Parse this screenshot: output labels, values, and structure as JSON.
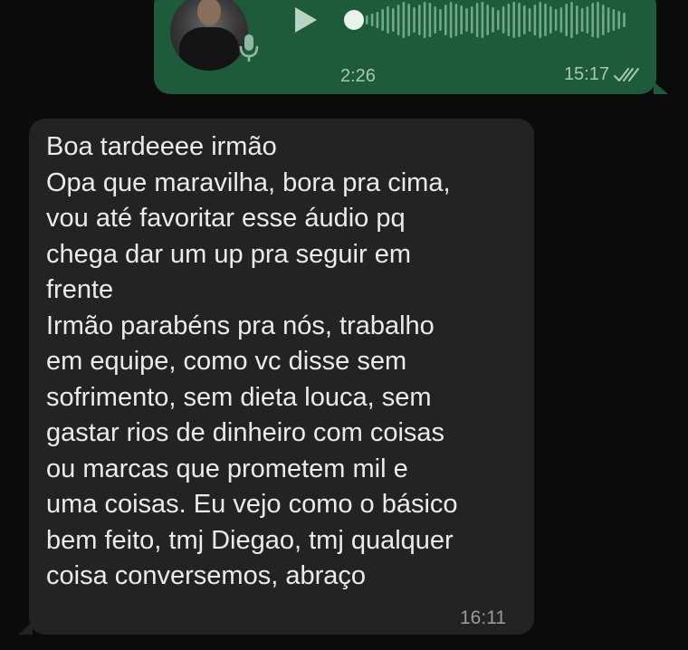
{
  "outgoing_voice_message": {
    "duration": "2:26",
    "time": "15:17",
    "playback_progress": 0.0,
    "status": "read",
    "bubble_color": "#1d5b3a"
  },
  "incoming_message": {
    "lines": [
      "Boa tardeeee irmão",
      "Opa que maravilha, bora pra cima,",
      "vou até favoritar esse áudio pq",
      "chega dar um up pra seguir em",
      "frente",
      "Irmão parabéns pra nós, trabalho",
      "em equipe, como vc disse sem",
      "sofrimento, sem dieta louca, sem",
      "gastar rios de dinheiro com coisas",
      "ou marcas que prometem mil e",
      "uma coisas. Eu vejo como o básico",
      "bem feito, tmj Diegao, tmj qualquer",
      "coisa conversemos, abraço"
    ],
    "time": "16:11",
    "bubble_color": "#232323"
  },
  "icons": {
    "play": "play-icon",
    "mic": "microphone-icon",
    "ticks": "double-check-icon"
  }
}
